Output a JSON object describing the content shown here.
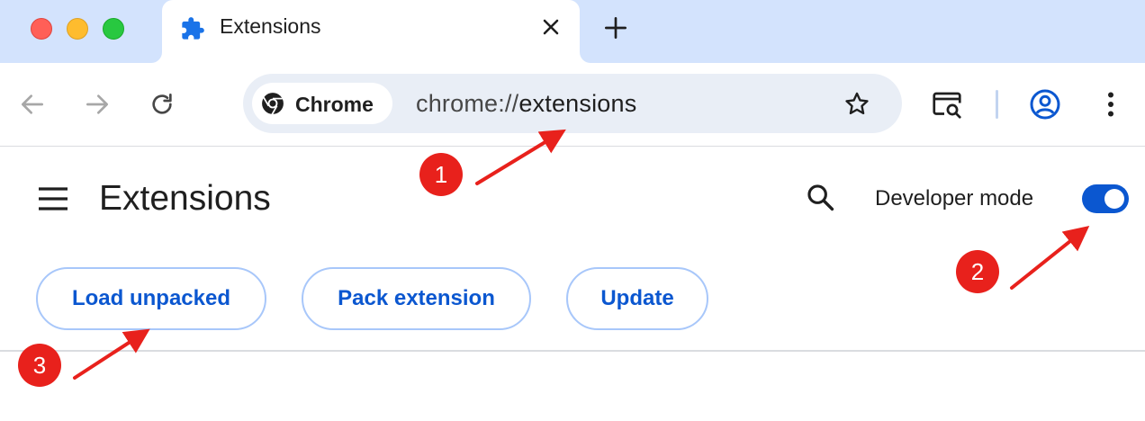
{
  "window": {
    "tab_title": "Extensions",
    "icons": {
      "tab": "puzzle-piece-icon",
      "close_tab": "close-icon",
      "new_tab": "plus-icon"
    }
  },
  "toolbar": {
    "chip_label": "Chrome",
    "url_scheme": "chrome://",
    "url_path": "extensions",
    "icons": [
      "back-arrow-icon",
      "forward-arrow-icon",
      "reload-icon",
      "chrome-logo-icon",
      "bookmark-star-icon",
      "tab-search-icon",
      "profile-icon",
      "more-menu-icon"
    ]
  },
  "extensions_page": {
    "title": "Extensions",
    "developer_mode_label": "Developer mode",
    "developer_mode_on": true,
    "buttons": {
      "load_unpacked": "Load unpacked",
      "pack_extension": "Pack extension",
      "update": "Update"
    }
  },
  "annotations": {
    "step1": "1",
    "step2": "2",
    "step3": "3",
    "color": "#e8211c"
  },
  "colors": {
    "accent": "#0b57d0",
    "tabstrip": "#d3e3fd",
    "omnibox": "#e9eef6",
    "button_border": "#a8c7fa"
  }
}
